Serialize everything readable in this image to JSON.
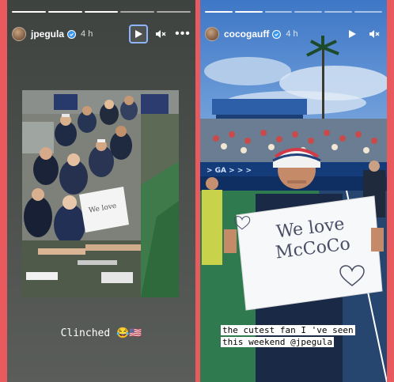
{
  "left_story": {
    "username": "jpegula",
    "time": "4 h",
    "caption": "Clinched 😂🇺🇸",
    "icons": {
      "verified": "verified-badge-icon",
      "play": "play-icon",
      "mute": "mute-icon",
      "more": "more-icon"
    }
  },
  "right_story": {
    "username": "cocogauff",
    "time": "4 h",
    "sign_text": "We love McCoCo",
    "caption_line1": "the cutest fan I 've seen",
    "caption_line2": "this weekend  @jpegula",
    "icons": {
      "verified": "verified-badge-icon",
      "play": "play-icon",
      "mute": "mute-icon"
    }
  },
  "colors": {
    "frame": "#e85a5e",
    "focus_ring": "#8fb4ff"
  }
}
